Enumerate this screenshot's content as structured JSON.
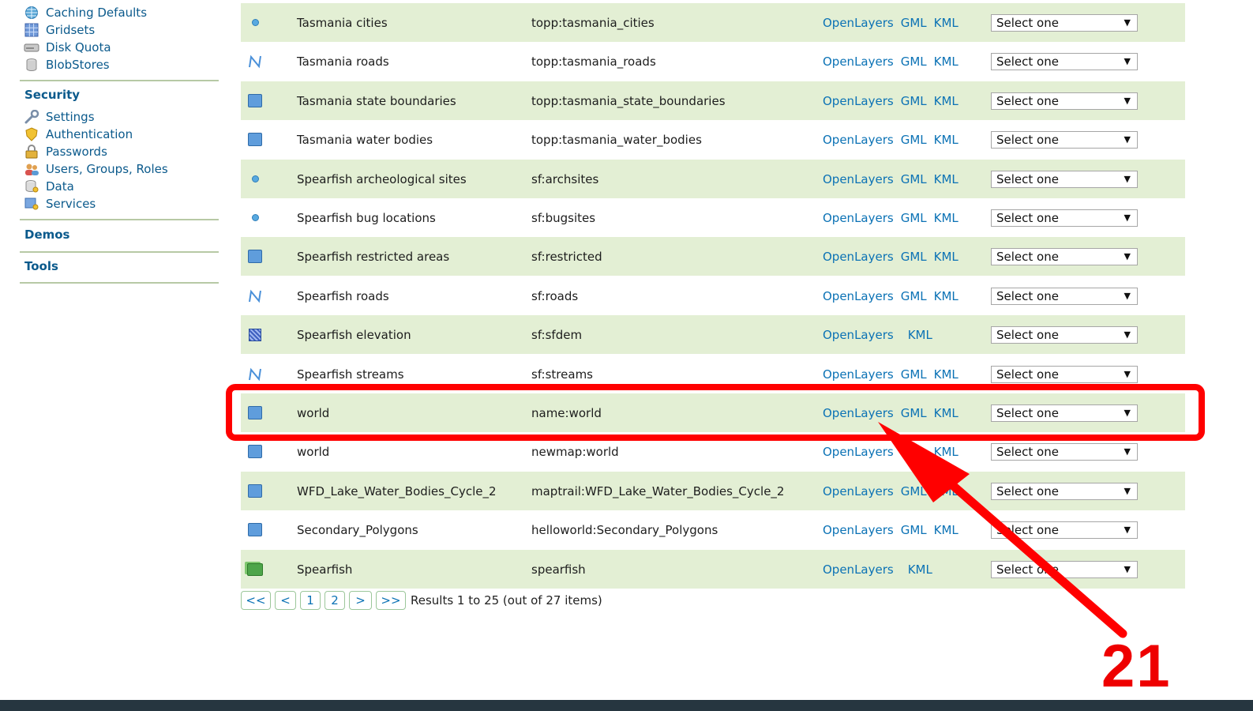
{
  "sidebar": {
    "items_top": [
      {
        "label": "Caching Defaults",
        "icon": "globe-grid-icon"
      },
      {
        "label": "Gridsets",
        "icon": "grid-icon"
      },
      {
        "label": "Disk Quota",
        "icon": "disk-icon"
      },
      {
        "label": "BlobStores",
        "icon": "blobstore-icon"
      }
    ],
    "security_heading": "Security",
    "security_items": [
      {
        "label": "Settings",
        "icon": "wrench-icon"
      },
      {
        "label": "Authentication",
        "icon": "shield-icon"
      },
      {
        "label": "Passwords",
        "icon": "lock-icon"
      },
      {
        "label": "Users, Groups, Roles",
        "icon": "users-icon"
      },
      {
        "label": "Data",
        "icon": "database-key-icon"
      },
      {
        "label": "Services",
        "icon": "services-key-icon"
      }
    ],
    "demos_heading": "Demos",
    "tools_heading": "Tools"
  },
  "table": {
    "rows": [
      {
        "type": "point",
        "title": "Tasmania cities",
        "name": "topp:tasmania_cities",
        "links": [
          "OpenLayers",
          "GML",
          "KML"
        ],
        "select": "Select one"
      },
      {
        "type": "line",
        "title": "Tasmania roads",
        "name": "topp:tasmania_roads",
        "links": [
          "OpenLayers",
          "GML",
          "KML"
        ],
        "select": "Select one"
      },
      {
        "type": "polygon",
        "title": "Tasmania state boundaries",
        "name": "topp:tasmania_state_boundaries",
        "links": [
          "OpenLayers",
          "GML",
          "KML"
        ],
        "select": "Select one"
      },
      {
        "type": "polygon",
        "title": "Tasmania water bodies",
        "name": "topp:tasmania_water_bodies",
        "links": [
          "OpenLayers",
          "GML",
          "KML"
        ],
        "select": "Select one"
      },
      {
        "type": "point",
        "title": "Spearfish archeological sites",
        "name": "sf:archsites",
        "links": [
          "OpenLayers",
          "GML",
          "KML"
        ],
        "select": "Select one"
      },
      {
        "type": "point",
        "title": "Spearfish bug locations",
        "name": "sf:bugsites",
        "links": [
          "OpenLayers",
          "GML",
          "KML"
        ],
        "select": "Select one"
      },
      {
        "type": "polygon",
        "title": "Spearfish restricted areas",
        "name": "sf:restricted",
        "links": [
          "OpenLayers",
          "GML",
          "KML"
        ],
        "select": "Select one"
      },
      {
        "type": "line",
        "title": "Spearfish roads",
        "name": "sf:roads",
        "links": [
          "OpenLayers",
          "GML",
          "KML"
        ],
        "select": "Select one"
      },
      {
        "type": "raster",
        "title": "Spearfish elevation",
        "name": "sf:sfdem",
        "links": [
          "OpenLayers",
          "",
          "KML"
        ],
        "select": "Select one"
      },
      {
        "type": "line",
        "title": "Spearfish streams",
        "name": "sf:streams",
        "links": [
          "OpenLayers",
          "GML",
          "KML"
        ],
        "select": "Select one"
      },
      {
        "type": "polygon",
        "title": "world",
        "name": "name:world",
        "links": [
          "OpenLayers",
          "GML",
          "KML"
        ],
        "select": "Select one"
      },
      {
        "type": "polygon",
        "title": "world",
        "name": "newmap:world",
        "links": [
          "OpenLayers",
          "GML",
          "KML"
        ],
        "select": "Select one"
      },
      {
        "type": "polygon",
        "title": "WFD_Lake_Water_Bodies_Cycle_2",
        "name": "maptrail:WFD_Lake_Water_Bodies_Cycle_2",
        "links": [
          "OpenLayers",
          "GML",
          "KML"
        ],
        "select": "Select one"
      },
      {
        "type": "polygon",
        "title": "Secondary_Polygons",
        "name": "helloworld:Secondary_Polygons",
        "links": [
          "OpenLayers",
          "GML",
          "KML"
        ],
        "select": "Select one"
      },
      {
        "type": "group",
        "title": "Spearfish",
        "name": "spearfish",
        "links": [
          "OpenLayers",
          "",
          "KML"
        ],
        "select": "Select one"
      }
    ]
  },
  "pager": {
    "first": "<<",
    "prev": "<",
    "page1": "1",
    "page2": "2",
    "next": ">",
    "last": ">>",
    "results": "Results 1 to 25 (out of 27 items)"
  },
  "annotation": {
    "step_number": "21",
    "color": "#ff0000"
  },
  "colors": {
    "row_alt": "#e3efd4",
    "link": "#0b72b5",
    "sidebar_link": "#0b5a8c"
  }
}
